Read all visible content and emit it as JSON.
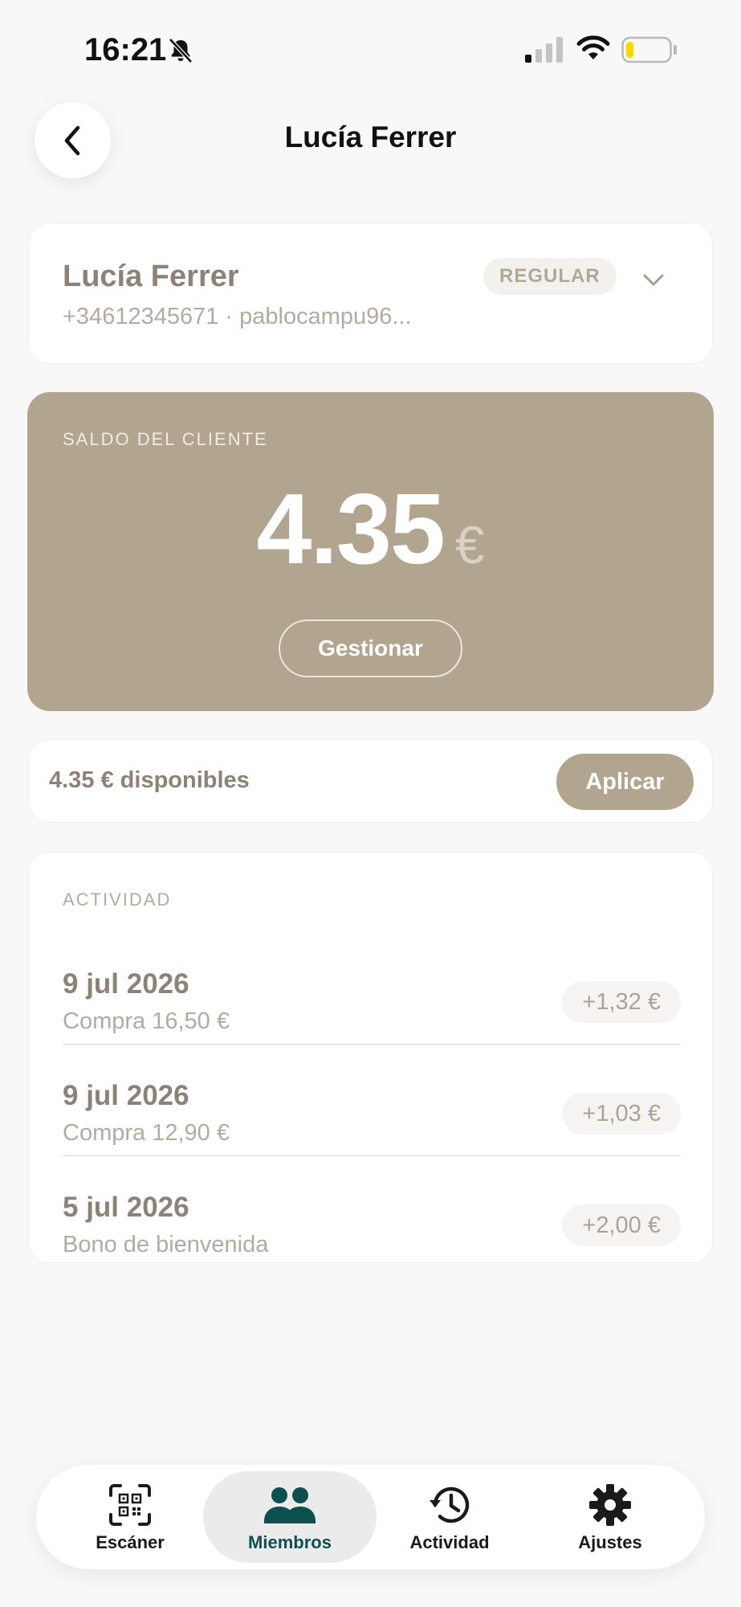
{
  "status_bar": {
    "time": "16:21"
  },
  "header": {
    "title": "Lucía Ferrer",
    "back_icon": "chevron-left-icon"
  },
  "member": {
    "name": "Lucía Ferrer",
    "contact": "+34612345671 · pablocampu96...",
    "tier": "REGULAR",
    "expand_icon": "chevron-down-icon"
  },
  "balance": {
    "label": "SALDO DEL CLIENTE",
    "amount": "4.35",
    "currency": "€",
    "manage_label": "Gestionar",
    "card_color": "#b1a590"
  },
  "available": {
    "text": "4.35 € disponibles",
    "apply_label": "Aplicar"
  },
  "activity": {
    "label": "ACTIVIDAD",
    "items": [
      {
        "date": "9 jul 2026",
        "description": "Compra 16,50 €",
        "amount": "+1,32 €"
      },
      {
        "date": "9 jul 2026",
        "description": "Compra 12,90 €",
        "amount": "+1,03 €"
      },
      {
        "date": "5 jul 2026",
        "description": "Bono de bienvenida",
        "amount": "+2,00 €"
      }
    ]
  },
  "tab_bar": {
    "active": "Miembros",
    "active_color": "#0e4f4f",
    "tabs": [
      {
        "label": "Escáner",
        "icon": "qr-scan-icon"
      },
      {
        "label": "Miembros",
        "icon": "members-icon"
      },
      {
        "label": "Actividad",
        "icon": "history-icon"
      },
      {
        "label": "Ajustes",
        "icon": "gear-icon"
      }
    ]
  }
}
